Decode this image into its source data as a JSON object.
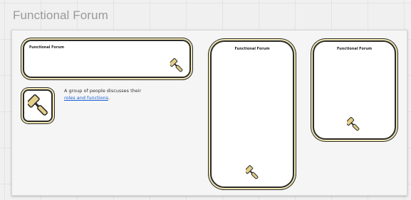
{
  "page": {
    "title": "Functional Forum"
  },
  "cards": {
    "wide": {
      "title": "Functional Forum",
      "icon": "paint-roller-icon"
    },
    "icon_tile": {
      "icon": "paint-roller-icon"
    },
    "tall": {
      "title": "Functional Forum",
      "icon": "paint-roller-icon"
    },
    "medium": {
      "title": "Functional Forum",
      "icon": "paint-roller-icon"
    }
  },
  "description": {
    "text_before": "A group of people discusses their ",
    "link_text": "roles and functions",
    "text_after": "."
  },
  "colors": {
    "card_border": "#2b2b2b",
    "card_inner_band": "#f1e6b2",
    "roller_handle": "#e4cd86",
    "link": "#1a5fd6",
    "page_title": "#9a9a9a"
  }
}
